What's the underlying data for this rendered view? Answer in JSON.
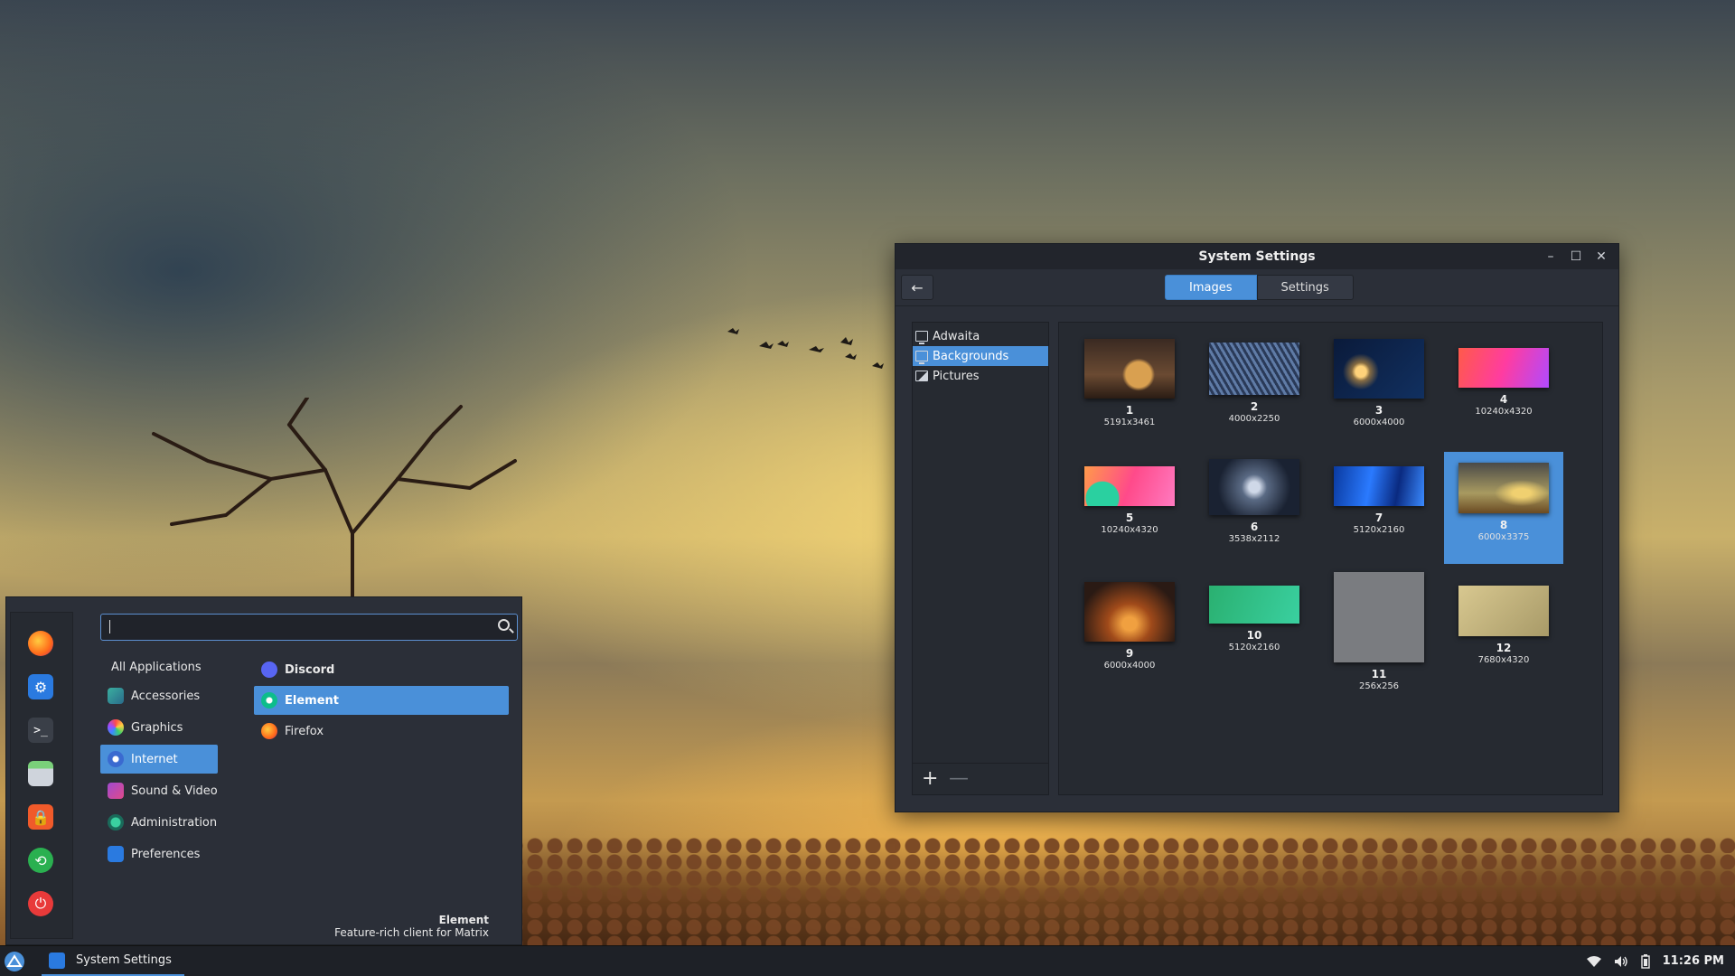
{
  "window": {
    "title": "System Settings",
    "controls": {
      "minimize": "–",
      "maximize": "☐",
      "close": "✕"
    },
    "back": "←",
    "tabs": [
      {
        "label": "Images",
        "active": true
      },
      {
        "label": "Settings",
        "active": false
      }
    ],
    "sources": [
      {
        "label": "Adwaita",
        "icon": "monitor-icon",
        "selected": false
      },
      {
        "label": "Backgrounds",
        "icon": "monitor-icon",
        "selected": true
      },
      {
        "label": "Pictures",
        "icon": "picture-icon",
        "selected": false
      }
    ],
    "tools": {
      "add": "+",
      "remove": "—"
    },
    "wallpapers": [
      {
        "num": "1",
        "dim": "5191x3461"
      },
      {
        "num": "2",
        "dim": "4000x2250"
      },
      {
        "num": "3",
        "dim": "6000x4000"
      },
      {
        "num": "4",
        "dim": "10240x4320"
      },
      {
        "num": "5",
        "dim": "10240x4320"
      },
      {
        "num": "6",
        "dim": "3538x2112"
      },
      {
        "num": "7",
        "dim": "5120x2160"
      },
      {
        "num": "8",
        "dim": "6000x3375",
        "selected": true
      },
      {
        "num": "9",
        "dim": "6000x4000"
      },
      {
        "num": "10",
        "dim": "5120x2160"
      },
      {
        "num": "11",
        "dim": "256x256"
      },
      {
        "num": "12",
        "dim": "7680x4320"
      }
    ]
  },
  "menu": {
    "search_value": "",
    "categories": [
      {
        "label": "All Applications",
        "icon": ""
      },
      {
        "label": "Accessories",
        "icon": "accessories-icon"
      },
      {
        "label": "Graphics",
        "icon": "graphics-icon"
      },
      {
        "label": "Internet",
        "icon": "internet-icon",
        "selected": true
      },
      {
        "label": "Sound & Video",
        "icon": "multimedia-icon"
      },
      {
        "label": "Administration",
        "icon": "administration-icon"
      },
      {
        "label": "Preferences",
        "icon": "preferences-icon"
      }
    ],
    "apps": [
      {
        "label": "Discord",
        "icon": "discord-icon",
        "bold": true
      },
      {
        "label": "Element",
        "icon": "element-icon",
        "selected": true
      },
      {
        "label": "Firefox",
        "icon": "firefox-icon"
      }
    ],
    "description": {
      "name": "Element",
      "text": "Feature-rich client for Matrix"
    },
    "favorites": [
      "firefox-icon",
      "settings-icon",
      "terminal-icon",
      "files-icon",
      "lock-icon",
      "logout-icon",
      "power-icon"
    ]
  },
  "panel": {
    "task_label": "System Settings",
    "clock": "11:26 PM"
  },
  "colors": {
    "accent": "#4a90d9",
    "window_bg": "#2b2f38",
    "panel_bg": "#1e2127"
  }
}
